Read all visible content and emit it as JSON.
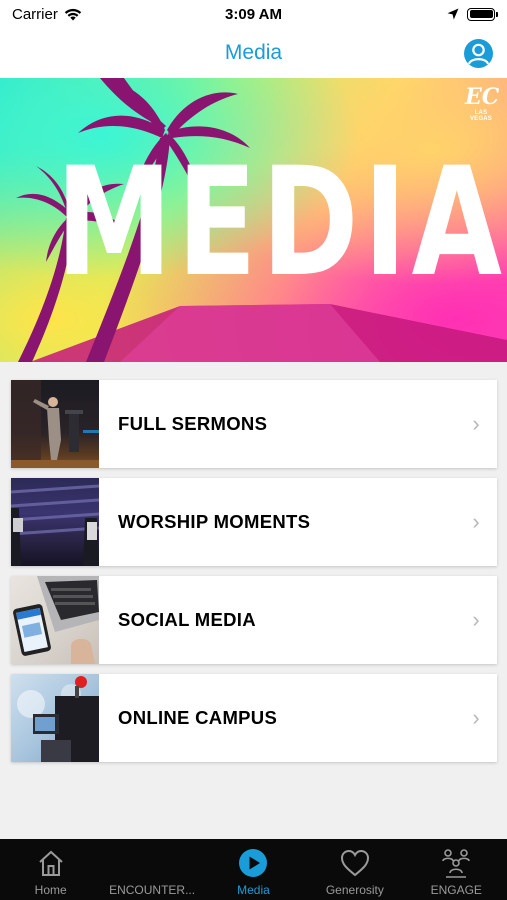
{
  "status_bar": {
    "carrier": "Carrier",
    "time": "3:09 AM"
  },
  "nav": {
    "title": "Media",
    "profile_icon": "person-circle-icon"
  },
  "hero": {
    "word": "MEDIA",
    "logo_mark": "EC",
    "logo_text": "LAS VEGAS"
  },
  "menu": {
    "items": [
      {
        "label": "FULL SERMONS",
        "thumb": "preacher-on-stage"
      },
      {
        "label": "WORSHIP MOMENTS",
        "thumb": "worship-stage"
      },
      {
        "label": "SOCIAL MEDIA",
        "thumb": "phone-and-laptop"
      },
      {
        "label": "ONLINE CAMPUS",
        "thumb": "camera-recording"
      }
    ],
    "chevron_icon": "chevron-right-icon"
  },
  "tabs": [
    {
      "label": "Home",
      "icon": "house-icon"
    },
    {
      "label": "ENCOUNTER...",
      "icon": ""
    },
    {
      "label": "Media",
      "icon": "play-circle-icon",
      "active": true
    },
    {
      "label": "Generosity",
      "icon": "heart-icon"
    },
    {
      "label": "ENGAGE",
      "icon": "group-icon"
    }
  ],
  "colors": {
    "accent": "#1a9cd8",
    "tab_bar": "#0a0a0a",
    "inactive_tab": "#9a9a9a"
  }
}
